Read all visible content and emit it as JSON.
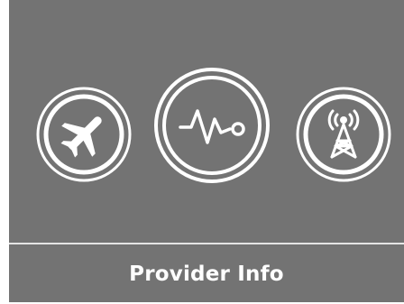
{
  "menu": {
    "items": [
      {
        "icon": "airplane-mode-icon"
      },
      {
        "icon": "diagnostics-waveform-icon",
        "selected": true
      },
      {
        "icon": "cell-tower-icon"
      }
    ]
  },
  "footer": {
    "label": "Provider Info"
  },
  "colors": {
    "background": "#737373",
    "foreground": "#ffffff",
    "divider": "#e4e4e4"
  }
}
